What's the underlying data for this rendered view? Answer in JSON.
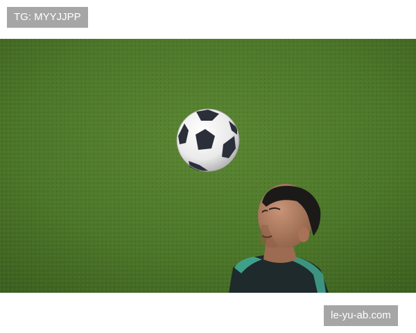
{
  "watermark_top": {
    "text": "TG: MYYJJPP"
  },
  "watermark_bottom": {
    "text": "le-yu-ab.com"
  },
  "photo": {
    "subject": "soccer player heading ball on grass field",
    "colors": {
      "grass": "#4f7a2c",
      "grass_dark": "#3e6322",
      "grass_light": "#6a8f3e",
      "ball_white": "#f4f4f4",
      "ball_panel": "#2b2f3a",
      "skin": "#b07e62",
      "hair": "#1c1a19",
      "shirt": "#1f2a2c",
      "shirt_trim": "#3fa08a"
    },
    "icons": [
      "soccer-ball-icon"
    ]
  }
}
